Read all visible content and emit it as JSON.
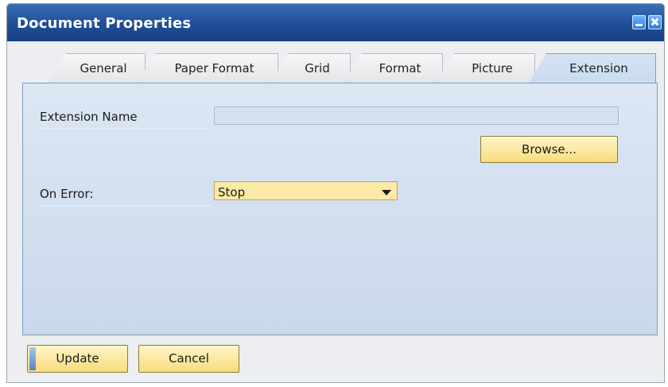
{
  "window": {
    "title": "Document Properties"
  },
  "tabs": [
    {
      "label": "General",
      "active": false
    },
    {
      "label": "Paper Format",
      "active": false
    },
    {
      "label": "Grid",
      "active": false
    },
    {
      "label": "Format",
      "active": false
    },
    {
      "label": "Picture",
      "active": false
    },
    {
      "label": "Extension",
      "active": true
    }
  ],
  "form": {
    "extension_name_label": "Extension Name",
    "extension_name_value": "",
    "browse_label": "Browse...",
    "on_error_label": "On Error:",
    "on_error_value": "Stop"
  },
  "footer": {
    "update_label": "Update",
    "cancel_label": "Cancel"
  },
  "colors": {
    "titlebar": "#21509a",
    "button_yellow": "#f7dc7b",
    "panel_blue": "#c9d8eb"
  }
}
